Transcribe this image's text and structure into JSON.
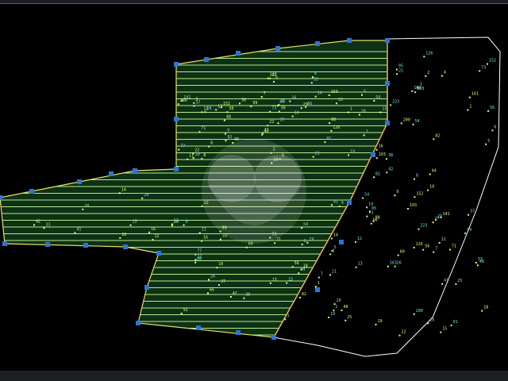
{
  "colors": {
    "background": "#000000",
    "outer_boundary": "#ffffff",
    "parcel_boundary": "#e8e06a",
    "hatch": "#b9e98a",
    "fill": "#0f3a18",
    "vertex": "#2a76d8",
    "marker": "#d8ff7a",
    "label_text": "#d8ff7a",
    "label_cyan": "#7fe0e6",
    "watermark": "#ffffff"
  },
  "canvas_labels": [
    "37",
    "38",
    "22",
    "7",
    "8",
    "9",
    "10",
    "11",
    "12",
    "13",
    "14",
    "15",
    "16",
    "18",
    "20",
    "26",
    "29",
    "33",
    "41",
    "42",
    "54",
    "56",
    "73",
    "82",
    "95",
    "103",
    "126",
    "141",
    "152",
    "163",
    "200",
    "223",
    "2",
    "4",
    "5",
    "6",
    "21",
    "1",
    "3",
    "19",
    "25",
    "44",
    "48",
    "60",
    "66",
    "71",
    "77",
    "88",
    "91",
    "99"
  ],
  "watermark": {
    "icon": "placeholder-logo-icon"
  }
}
